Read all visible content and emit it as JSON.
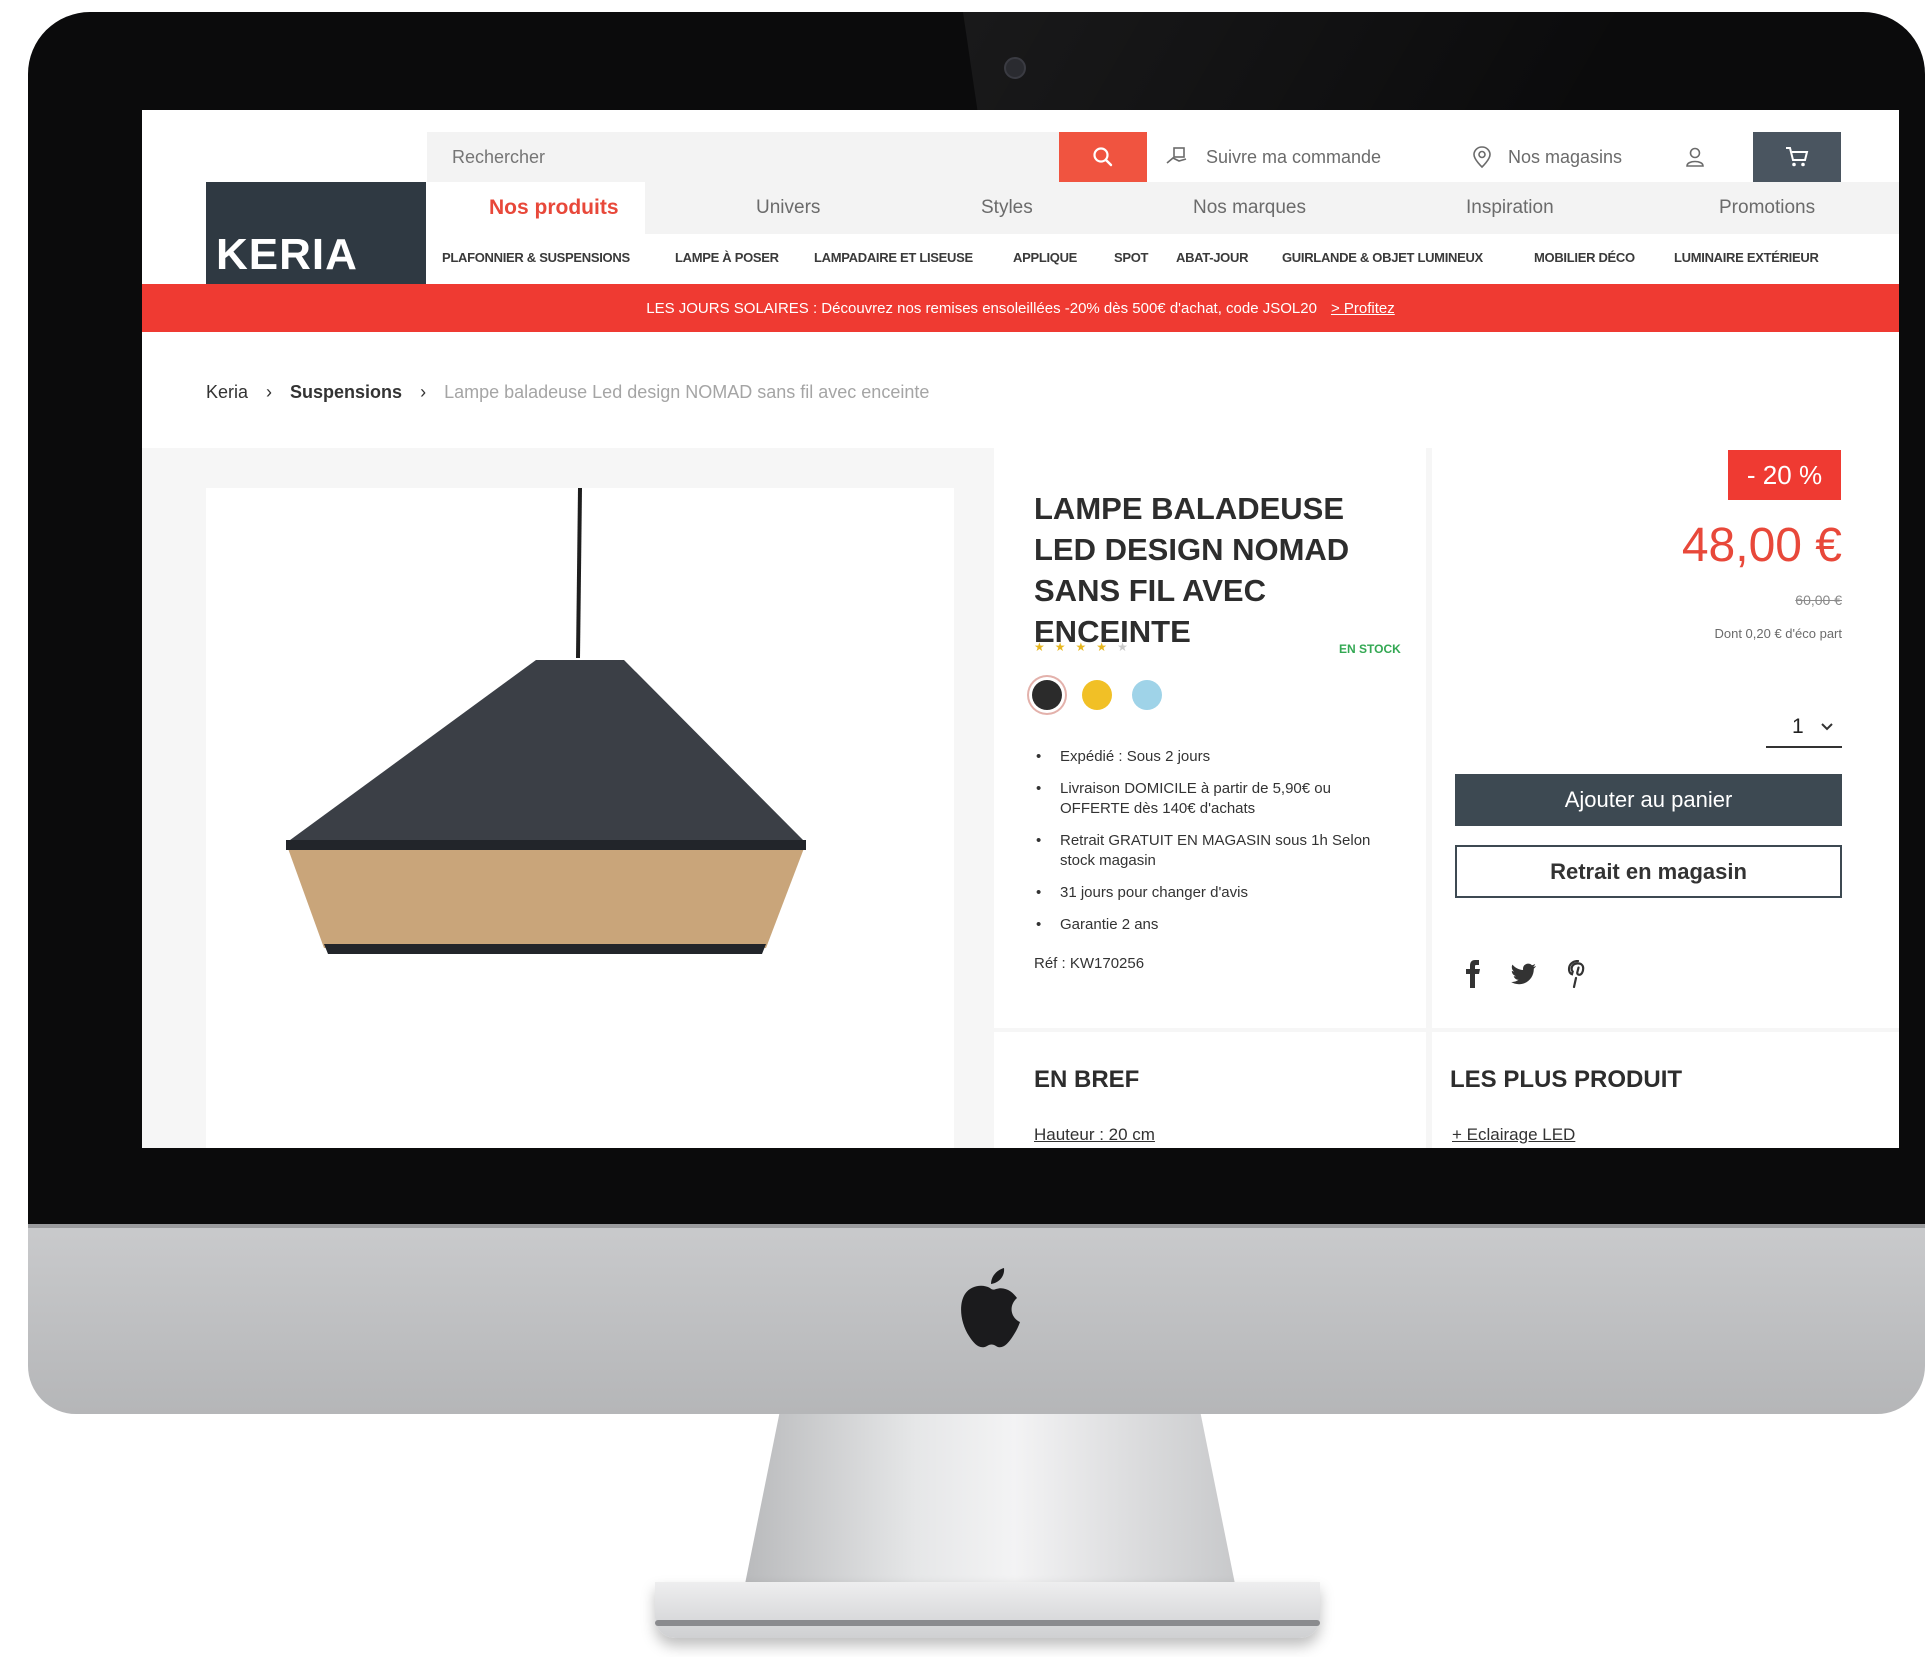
{
  "site": {
    "logo": "KERIA",
    "search_placeholder": "Rechercher",
    "track_order": "Suivre ma commande",
    "stores": "Nos magasins"
  },
  "nav": {
    "items": [
      "Nos produits",
      "Univers",
      "Styles",
      "Nos marques",
      "Inspiration",
      "Promotions"
    ]
  },
  "categories": [
    "PLAFONNIER & SUSPENSIONS",
    "LAMPE À POSER",
    "LAMPADAIRE ET LISEUSE",
    "APPLIQUE",
    "SPOT",
    "ABAT-JOUR",
    "GUIRLANDE & OBJET LUMINEUX",
    "MOBILIER DÉCO",
    "LUMINAIRE EXTÉRIEUR"
  ],
  "promo": {
    "text": "LES JOURS SOLAIRES : Découvrez nos remises ensoleillées  -20% dès 500€ d'achat, code JSOL20",
    "link": "> Profitez"
  },
  "breadcrumb": [
    "Keria",
    "Suspensions",
    "Lampe baladeuse Led design NOMAD sans fil avec enceinte"
  ],
  "product": {
    "title": "LAMPE BALADEUSE LED DESIGN NOMAD SANS FIL AVEC ENCEINTE",
    "rating": 4,
    "rating_max": 5,
    "stock": "EN STOCK",
    "colors": [
      "#2b2b2b",
      "#f1c026",
      "#9fd3e8"
    ],
    "features": [
      "Expédié : Sous 2 jours",
      "Livraison DOMICILE à partir de 5,90€ ou OFFERTE dès 140€ d'achats",
      "Retrait GRATUIT EN MAGASIN sous 1h Selon stock magasin",
      "31 jours pour changer d'avis",
      "Garantie 2 ans"
    ],
    "ref": "Réf : KW170256",
    "discount": "- 20 %",
    "price": "48,00 €",
    "old_price": "60,00 €",
    "eco_part": "Dont 0,20 € d'éco part",
    "quantity": "1",
    "add_to_cart": "Ajouter au panier",
    "store_pickup": "Retrait en magasin"
  },
  "sections": {
    "brief_title": "EN BREF",
    "brief_line": "Hauteur : 20 cm",
    "plus_title": "LES PLUS PRODUIT",
    "plus_line": "+ Eclairage LED"
  },
  "colors": {
    "accent": "#ef3a32",
    "dark": "#2f3942",
    "button": "#3d4952"
  }
}
